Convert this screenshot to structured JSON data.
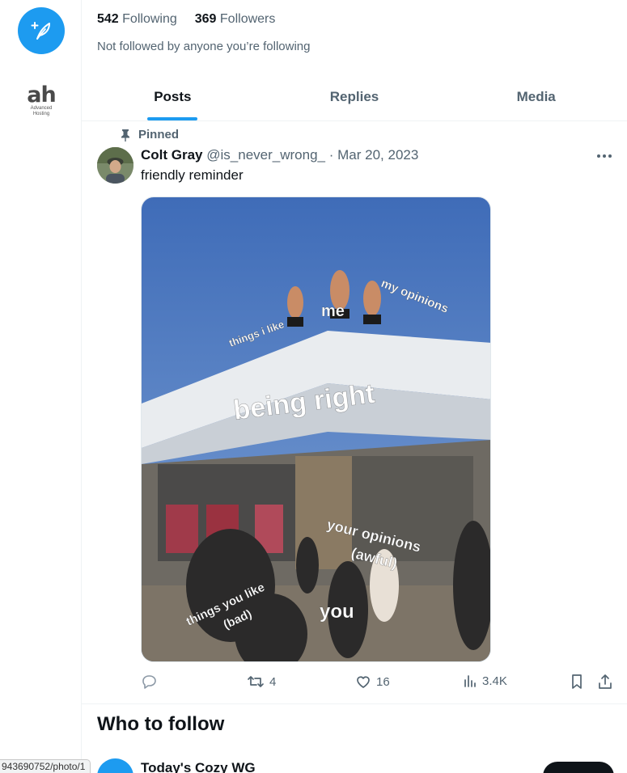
{
  "profile": {
    "following_count": "542",
    "following_label": "Following",
    "followers_count": "369",
    "followers_label": "Followers",
    "followed_note": "Not followed by anyone you’re following"
  },
  "rail": {
    "logo_main": "ah",
    "logo_sub_1": "Advanced",
    "logo_sub_2": "Hosting",
    "compose_icon": "feather-plus-icon",
    "accent": "#1d9bf0"
  },
  "tabs": [
    {
      "label": "Posts",
      "active": true
    },
    {
      "label": "Replies",
      "active": false
    },
    {
      "label": "Media",
      "active": false
    }
  ],
  "tweet": {
    "pinned_label": "Pinned",
    "author_name": "Colt Gray",
    "handle": "@is_never_wrong_",
    "separator": "·",
    "date": "Mar 20, 2023",
    "text": "friendly reminder",
    "meme_labels": {
      "things_i_like": "things i like",
      "me": "me",
      "my_opinions": "my opinions",
      "being_right": "being right",
      "your_opinions": "your opinions",
      "awful": "(awful)",
      "things_you_like": "things you like",
      "bad": "(bad)",
      "you": "you"
    },
    "replies": "",
    "reposts": "4",
    "likes": "16",
    "views": "3.4K"
  },
  "who_to_follow": {
    "title": "Who to follow",
    "suggestion_name": "Today's Cozy WG"
  },
  "status_bar": {
    "url": "943690752/photo/1"
  }
}
